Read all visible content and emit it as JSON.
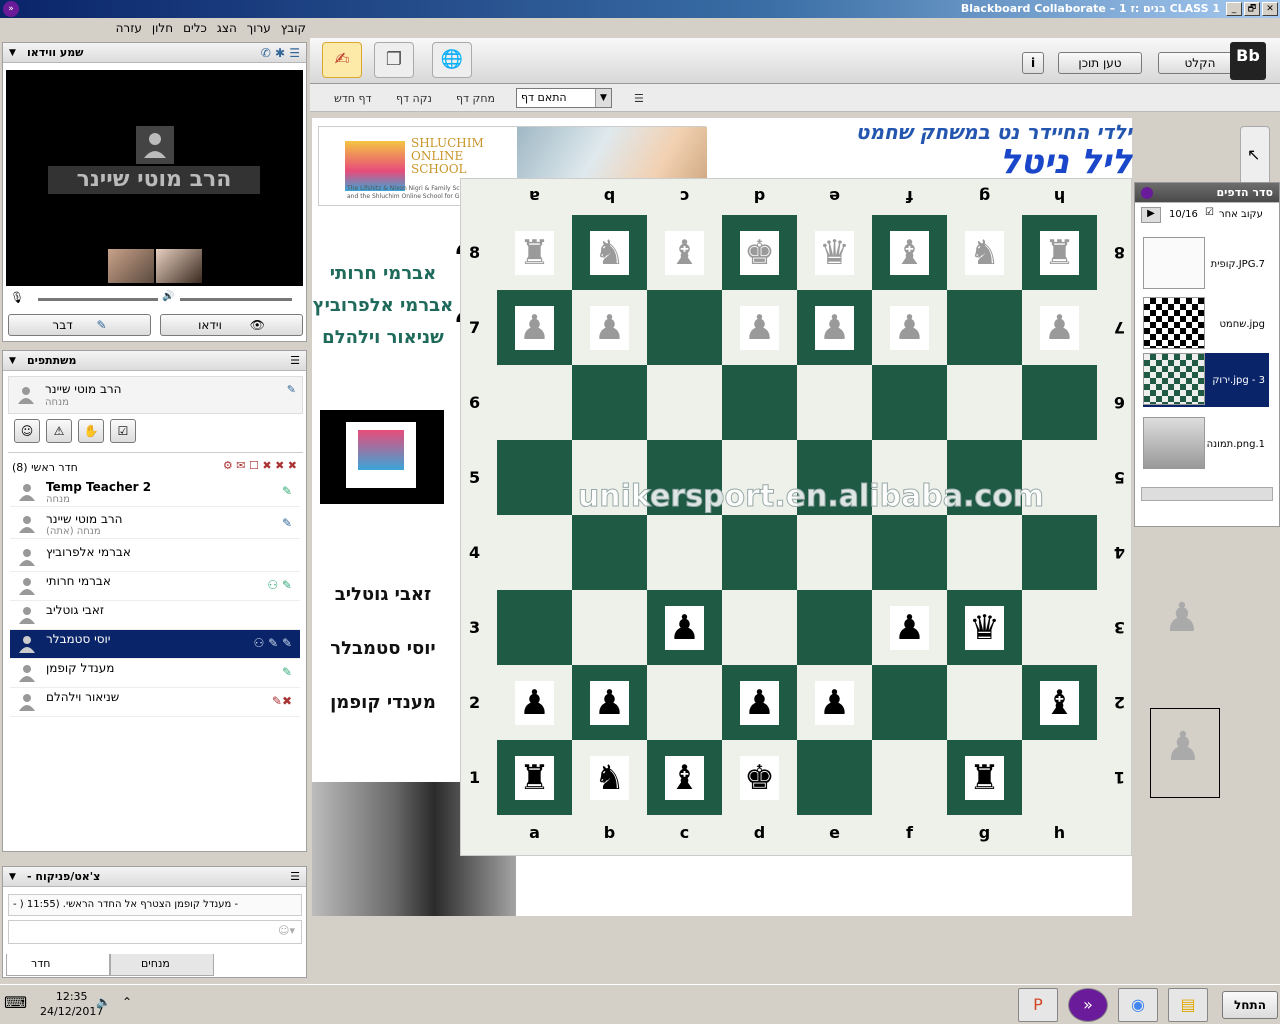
{
  "window": {
    "title": "Blackboard Collaborate – 1 בנים :ז CLASS 1",
    "min": "_",
    "max": "🗗",
    "close": "✕"
  },
  "menu": [
    "קובץ",
    "ערוך",
    "הצג",
    "כלים",
    "חלון",
    "עזרה"
  ],
  "audio_video": {
    "header": "שמע ווידאו",
    "presenter_name": "הרב מוטי שיינר",
    "talk_label": "דבר",
    "video_label": "וידאו"
  },
  "participants": {
    "header": "משתתפים",
    "me": {
      "name": "הרב מוטי שיינר",
      "role": "מנחה"
    },
    "room_label": "חדר ראשי",
    "room_count": "(8)",
    "list": [
      {
        "name": "Temp Teacher 2",
        "role": "מנחה",
        "bold": true
      },
      {
        "name": "הרב מוטי שיינר",
        "role": "מנחה (אתה)",
        "bold": false
      },
      {
        "name": "אברמי אלפרוביץ",
        "role": "",
        "bold": false
      },
      {
        "name": "אברמי חרותי",
        "role": "",
        "bold": false
      },
      {
        "name": "זאבי גוטליב",
        "role": "",
        "bold": false
      },
      {
        "name": "יוסי סטמבלר",
        "role": "",
        "bold": false,
        "selected": true
      },
      {
        "name": "מענדל קופמן",
        "role": "",
        "bold": false
      },
      {
        "name": "שניאור וילהלם",
        "role": "",
        "bold": false
      }
    ]
  },
  "chat": {
    "header": "- צ'אט/פניקוח",
    "message": "- ) מענדל קופמן הצטרף אל החדר הראשי. (11:55 -",
    "tab_room": "חדר",
    "tab_moderators": "מנחים"
  },
  "toolbar": {
    "step_back": "הקלט",
    "load_content": "טען תוכן",
    "info": "i",
    "new_page": "דף חדש",
    "clear_page": "נקה דף",
    "delete_page": "מחק דף",
    "fit_page": "התאם דף"
  },
  "canvas": {
    "title_line1": "ילדי החיידר נט במשחק שחמט",
    "title_line2": "ליל ניטל",
    "school_line1": "SHLUCHIM",
    "school_line2": "ONLINE",
    "school_line3": "SCHOOL",
    "school_line4": "The Lifshitz & Nixon Nigri & Family School for Boys",
    "school_line5": "and the Shluchim Online School for Girls",
    "team1": [
      "אברמי חרותי",
      "אברמי אלפרוביץ",
      "שניאור וילהלם"
    ],
    "team2": [
      "זאבי גוטליב",
      "יוסי סטמבלר",
      "מענדי קופמן"
    ],
    "watermark": "unikersport.en.alibaba.com",
    "files": [
      "h",
      "g",
      "f",
      "e",
      "d",
      "c",
      "b",
      "a"
    ],
    "files_top": [
      "h",
      "g",
      "f",
      "e",
      "d",
      "c",
      "b",
      "a"
    ],
    "ranks": [
      "8",
      "7",
      "6",
      "5",
      "4",
      "3",
      "2",
      "1"
    ]
  },
  "page_sorter": {
    "header": "סדר הדפים",
    "follow_label": "עקוב אחר",
    "page_counter": "10/16",
    "items": [
      "קופית.JPG.7",
      "שחמט.jpg",
      "ירוק.jpg - 3",
      "תמונה.png.1"
    ]
  },
  "taskbar": {
    "start": "התחל",
    "time": "12:35",
    "date": "24/12/2017"
  }
}
